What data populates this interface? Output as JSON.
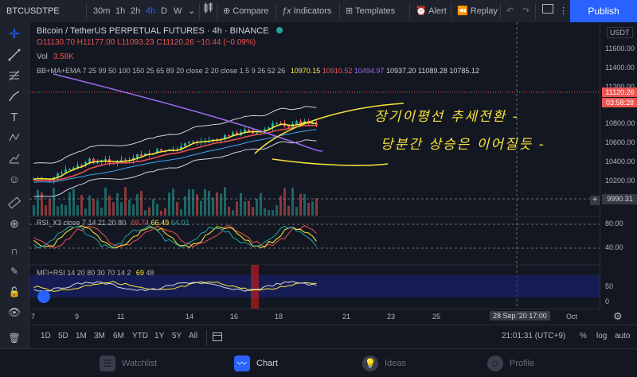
{
  "toolbar": {
    "symbol": "BTCUSDTPE",
    "intervals": [
      "30m",
      "1h",
      "2h",
      "4h",
      "D",
      "W"
    ],
    "active_interval": "4h",
    "compare": "Compare",
    "indicators": "Indicators",
    "templates": "Templates",
    "alert": "Alert",
    "replay": "Replay",
    "publish": "Publish"
  },
  "legend": {
    "title": "Bitcoin / TetherUS PERPETUAL FUTURES · 4h · BINANCE",
    "ohlc_o": "O11130.70",
    "ohlc_h": "H11177.00",
    "ohlc_l": "L11093.23",
    "ohlc_c": "C11120.26",
    "ohlc_chg": "−10.44 (−0.09%)",
    "vol_label": "Vol",
    "vol_value": "3.58K",
    "bb_label": "BB+MA+EMA  7 25 99 50 100 150 25 65 89 20 close 2 20 close 1.5 9 26 52 26",
    "bb_values": [
      "10970.15",
      "10910.52",
      "10494.97",
      "10937.20",
      "11089.28",
      "10785.12"
    ],
    "rsi_label": "RSI_X3  close 7 14 21  20 80",
    "rsi_values": [
      "69.74",
      "66.49",
      "64.02"
    ],
    "mfi_label": "MFI+RSI  14 20 80 30 70 14 2",
    "mfi_values": [
      "69",
      "48"
    ]
  },
  "price_axis": {
    "currency": "USDT",
    "ticks": [
      "11600.00",
      "11400.00",
      "11200.00",
      "10800.00",
      "10600.00",
      "10400.00",
      "10200.00"
    ],
    "last_price": "11120.26",
    "countdown": "03:58:28",
    "crosshair_price": "9990.31",
    "rsi_ticks": [
      "80.00",
      "40.00"
    ],
    "mfi_ticks": [
      "50",
      "0"
    ]
  },
  "time_axis": {
    "ticks": [
      "7",
      "9",
      "11",
      "14",
      "16",
      "18",
      "21",
      "23",
      "25",
      "Oct"
    ],
    "crosshair_time": "28 Sep '20   17:00"
  },
  "bottom": {
    "ranges": [
      "1D",
      "5D",
      "1M",
      "3M",
      "6M",
      "YTD",
      "1Y",
      "5Y",
      "All"
    ],
    "clock": "21:01:31 (UTC+9)",
    "percent": "%",
    "log": "log",
    "auto": "auto"
  },
  "annotation": {
    "line1": "장기이평선 추세전환 -",
    "line2": "당분간 상승은 이어질듯 -"
  },
  "nav": {
    "watchlist": "Watchlist",
    "chart": "Chart",
    "ideas": "Ideas",
    "profile": "Profile"
  },
  "colors": {
    "accent": "#2962ff",
    "up": "#26a69a",
    "down": "#ef5350",
    "ma_yellow": "#ffeb3b",
    "ma_purple": "#9c6cf0",
    "annotation_yellow": "#f7e43a"
  }
}
